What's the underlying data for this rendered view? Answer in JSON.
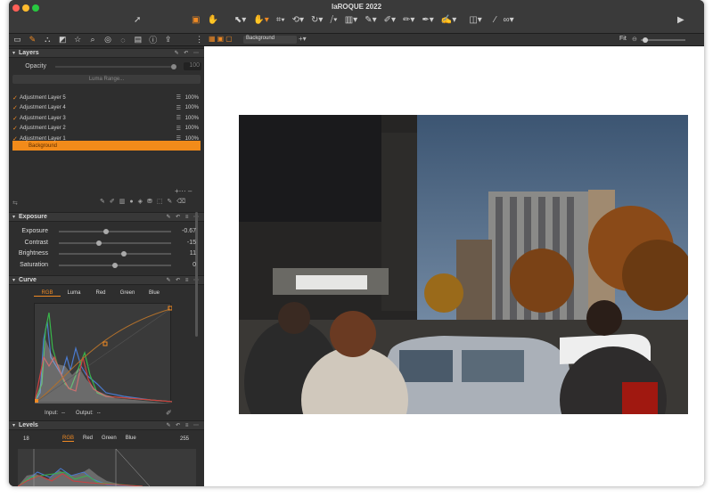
{
  "window": {
    "title": "laROQUE 2022"
  },
  "toolbar": {
    "tools": [
      "cursor-icon",
      "camera-icon",
      "hand-icon",
      "crop-icon",
      "rotate-icon",
      "brush-icon",
      "eraser-icon",
      "gradient-icon",
      "picker-icon",
      "compare-icon",
      "eyedropper-icon",
      "glasses-icon"
    ]
  },
  "panel_tabs": [
    "folder-icon",
    "brush-icon",
    "adjust-icon",
    "layers-icon",
    "star-icon",
    "search-icon",
    "circle-icon",
    "refresh-icon",
    "list-icon",
    "info-icon",
    "share-icon"
  ],
  "canvas_toolbar": {
    "background_select": "Background",
    "fit_label": "Fit"
  },
  "layers": {
    "title": "Layers",
    "opacity_label": "Opacity",
    "opacity_value": "100",
    "luma_range_label": "Luma Range...",
    "items": [
      {
        "name": "Adjustment Layer 5",
        "opacity": "100%"
      },
      {
        "name": "Adjustment Layer 4",
        "opacity": "100%"
      },
      {
        "name": "Adjustment Layer 3",
        "opacity": "100%"
      },
      {
        "name": "Adjustment Layer 2",
        "opacity": "100%"
      },
      {
        "name": "Adjustment Layer 1",
        "opacity": "100%"
      }
    ],
    "background_label": "Background"
  },
  "exposure": {
    "title": "Exposure",
    "sliders": [
      {
        "label": "Exposure",
        "value": "-0.67",
        "level": 0.42
      },
      {
        "label": "Contrast",
        "value": "-15",
        "level": 0.36
      },
      {
        "label": "Brightness",
        "value": "11",
        "level": 0.58
      },
      {
        "label": "Saturation",
        "value": "0",
        "level": 0.5
      }
    ]
  },
  "curve": {
    "title": "Curve",
    "tabs": [
      "RGB",
      "Luma",
      "Red",
      "Green",
      "Blue"
    ],
    "input_label": "Input:",
    "input_value": "--",
    "output_label": "Output:",
    "output_value": "--"
  },
  "levels": {
    "title": "Levels",
    "low_value": "18",
    "high_value": "255",
    "tabs": [
      "RGB",
      "Red",
      "Green",
      "Blue"
    ]
  },
  "colors": {
    "accent": "#f08a24"
  }
}
